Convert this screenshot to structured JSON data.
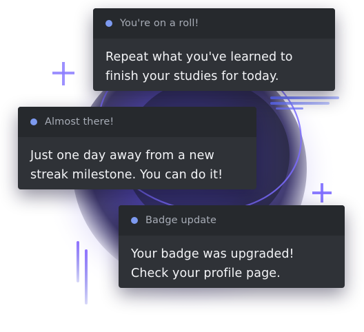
{
  "notifications": [
    {
      "title": "You're on a roll!",
      "message_line_1": "Repeat what you've learned to",
      "message_line_2": "finish your studies for today."
    },
    {
      "title": "Almost there!",
      "message_line_1": "Just one day away from a new",
      "message_line_2": "streak milestone. You can do it!"
    },
    {
      "title": "Badge update",
      "message_line_1": "Your badge was upgraded!",
      "message_line_2": "Check your profile page."
    }
  ],
  "colors": {
    "card_background": "#2f3237",
    "card_header": "#26292d",
    "status_dot": "#7d9af0",
    "title_text": "#a7acb6",
    "message_text": "#f3f4f7",
    "glow_accent": "#6c5cf5"
  },
  "icons": [
    "status-dot-icon",
    "sparkle-plus-icon",
    "speed-lines-decoration",
    "orbit-ring-decoration"
  ]
}
